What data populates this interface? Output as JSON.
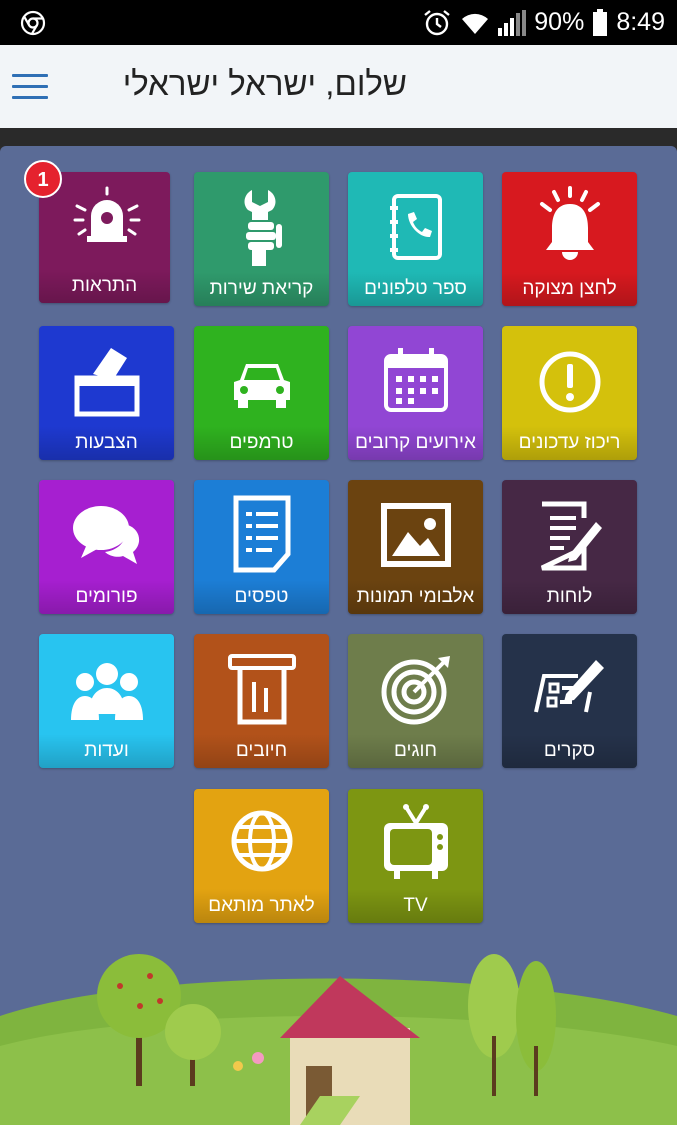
{
  "status_bar": {
    "battery": "90%",
    "time": "8:49"
  },
  "header": {
    "greeting": "שלום, ישראל ישראלי"
  },
  "tiles": [
    {
      "label": "לחצן מצוקה",
      "color": "#d7191f",
      "icon": "alarm-bell-icon"
    },
    {
      "label": "ספר טלפונים",
      "color": "#1fb9b5",
      "icon": "phonebook-icon"
    },
    {
      "label": "קריאת שירות",
      "color": "#2f9a6c",
      "icon": "wrench-hand-icon"
    },
    {
      "label": "התראות",
      "color": "#7d1a5c",
      "icon": "ringing-bell-icon",
      "badge": "1"
    },
    {
      "label": "ריכוז עדכונים",
      "color": "#d4c10c",
      "icon": "exclamation-icon"
    },
    {
      "label": "אירועים קרובים",
      "color": "#9146d4",
      "icon": "calendar-icon"
    },
    {
      "label": "טרמפים",
      "color": "#2fb21f",
      "icon": "car-icon"
    },
    {
      "label": "הצבעות",
      "color": "#1e39d0",
      "icon": "ballot-box-icon"
    },
    {
      "label": "לוחות",
      "color": "#462845",
      "icon": "notepad-icon"
    },
    {
      "label": "אלבומי תמונות",
      "color": "#6b4310",
      "icon": "picture-icon"
    },
    {
      "label": "טפסים",
      "color": "#1c7ed6",
      "icon": "form-document-icon"
    },
    {
      "label": "פורומים",
      "color": "#a61fd0",
      "icon": "speech-bubbles-icon"
    },
    {
      "label": "סקרים",
      "color": "#25324a",
      "icon": "survey-checklist-icon"
    },
    {
      "label": "חוגים",
      "color": "#6e7d4b",
      "icon": "target-icon"
    },
    {
      "label": "חיובים",
      "color": "#b2521a",
      "icon": "receipt-icon"
    },
    {
      "label": "ועדות",
      "color": "#28c4f0",
      "icon": "group-icon"
    },
    {
      "label": "TV",
      "color": "#7d9612",
      "icon": "tv-icon"
    },
    {
      "label": "לאתר מותאם",
      "color": "#e3a311",
      "icon": "globe-icon"
    }
  ]
}
